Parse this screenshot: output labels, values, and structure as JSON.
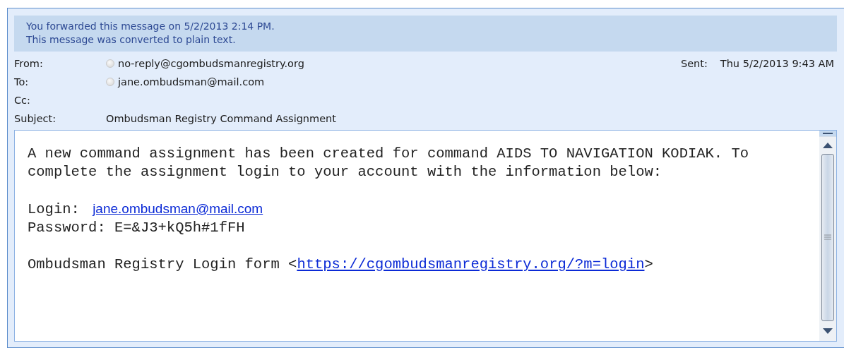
{
  "info_bar": [
    "You forwarded this message on 5/2/2013 2:14 PM.",
    "This message was converted to plain text."
  ],
  "header": {
    "fields": [
      {
        "kind": "contact",
        "label": "From:",
        "value": "no-reply@cgombudsmanregistry.org"
      },
      {
        "kind": "contact",
        "label": "To:",
        "value": "jane.ombudsman@mail.com"
      },
      {
        "kind": "text",
        "label": "Cc:"
      },
      {
        "kind": "text",
        "label": "Subject:",
        "value": "Ombudsman Registry Command Assignment"
      }
    ],
    "sent": {
      "label": "Sent:",
      "value": "Thu 5/2/2013 9:43 AM"
    }
  },
  "body": {
    "intro": "A new command assignment has been created for command AIDS TO NAVIGATION KODIAK. To complete the assignment login to your account with the information below:",
    "login": {
      "label": "Login:",
      "link": "jane.ombudsman@mail.com"
    },
    "password": "Password: E=&J3+kQ5h#1fFH",
    "form_link": {
      "prefix": "Ombudsman Registry Login form <",
      "link": "https://cgombudsmanregistry.org/?m=login",
      "suffix": ">"
    }
  }
}
